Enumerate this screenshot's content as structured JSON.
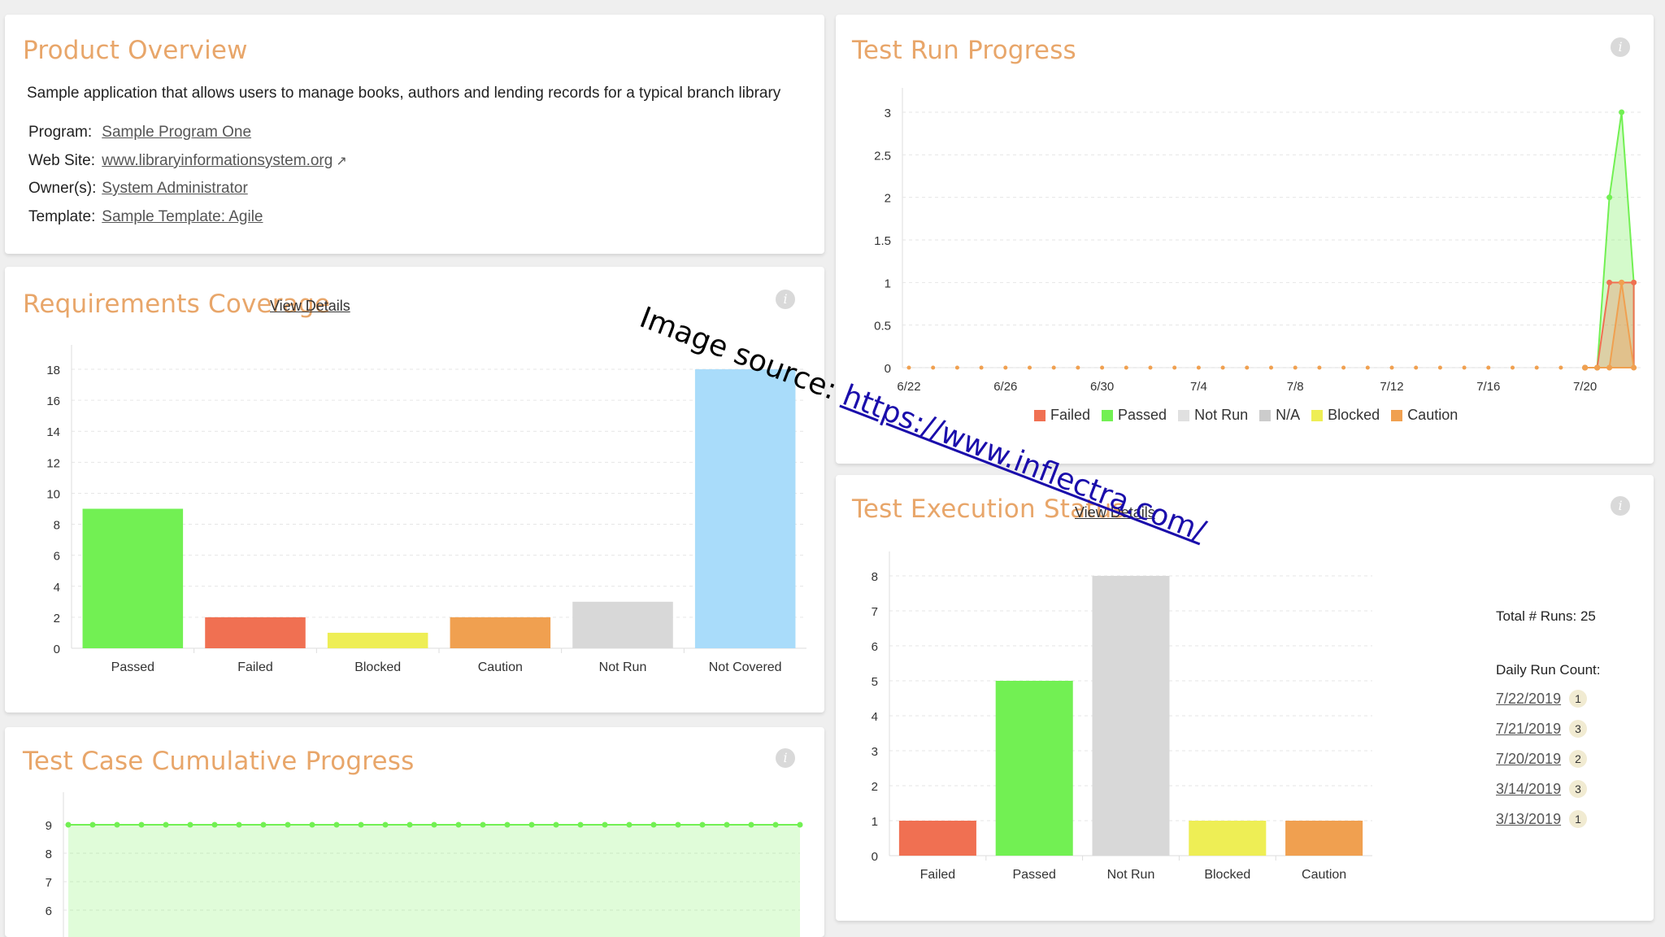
{
  "product_overview": {
    "title": "Product Overview",
    "description": "Sample application that allows users to manage books, authors and lending records for a typical branch library",
    "program_label": "Program:",
    "program_value": "Sample Program One",
    "website_label": "Web Site:",
    "website_value": "www.libraryinformationsystem.org",
    "owner_label": "Owner(s):",
    "owner_value": "System Administrator",
    "template_label": "Template:",
    "template_value": "Sample Template: Agile"
  },
  "requirements_coverage": {
    "title": "Requirements Coverage",
    "view_details": "View Details",
    "chart_data": {
      "type": "bar",
      "categories": [
        "Passed",
        "Failed",
        "Blocked",
        "Caution",
        "Not Run",
        "Not Covered"
      ],
      "values": [
        9,
        2,
        1,
        2,
        3,
        18
      ],
      "colors": [
        "#72f053",
        "#f07052",
        "#eeee55",
        "#f0a050",
        "#d8d8d8",
        "#a9dcfa"
      ],
      "yticks": [
        0,
        2,
        4,
        6,
        8,
        10,
        12,
        14,
        16,
        18
      ],
      "ylim": [
        0,
        18
      ]
    }
  },
  "test_case_cumulative": {
    "title": "Test Case Cumulative Progress",
    "chart_data": {
      "type": "area",
      "yticks": [
        6,
        7,
        8,
        9
      ],
      "value": 9,
      "points": 31,
      "color": "#72f053"
    }
  },
  "test_run_progress": {
    "title": "Test Run Progress",
    "legend": [
      "Failed",
      "Passed",
      "Not Run",
      "N/A",
      "Blocked",
      "Caution"
    ],
    "legend_colors": [
      "#f07052",
      "#72f053",
      "#e0e0e0",
      "#cccccc",
      "#eeee55",
      "#f0a050"
    ],
    "chart_data": {
      "type": "area",
      "xticks": [
        "6/22",
        "6/26",
        "6/30",
        "7/4",
        "7/8",
        "7/12",
        "7/16",
        "7/20"
      ],
      "yticks": [
        "0",
        "0.5",
        "1",
        "1.5",
        "2",
        "2.5",
        "3"
      ],
      "ylim": [
        0,
        3
      ],
      "series": [
        {
          "name": "Passed",
          "color": "#72f053",
          "tail": [
            0,
            0,
            2,
            3,
            1
          ]
        },
        {
          "name": "Failed",
          "color": "#f07052",
          "tail": [
            0,
            0,
            1,
            1,
            1
          ]
        },
        {
          "name": "Caution",
          "color": "#f0a050",
          "tail": [
            0,
            0,
            0,
            1,
            0
          ]
        }
      ]
    }
  },
  "test_execution_status": {
    "title": "Test Execution Status",
    "view_details": "View Details",
    "total_runs": "Total # Runs: 25",
    "daily_run_count_label": "Daily Run Count:",
    "daily_runs": [
      {
        "date": "7/22/2019",
        "count": "1"
      },
      {
        "date": "7/21/2019",
        "count": "3"
      },
      {
        "date": "7/20/2019",
        "count": "2"
      },
      {
        "date": "3/14/2019",
        "count": "3"
      },
      {
        "date": "3/13/2019",
        "count": "1"
      }
    ],
    "chart_data": {
      "type": "bar",
      "categories": [
        "Failed",
        "Passed",
        "Not Run",
        "Blocked",
        "Caution"
      ],
      "values": [
        1,
        5,
        8,
        1,
        1
      ],
      "colors": [
        "#f07052",
        "#72f053",
        "#d8d8d8",
        "#eeee55",
        "#f0a050"
      ],
      "yticks": [
        0,
        1,
        2,
        3,
        4,
        5,
        6,
        7,
        8
      ],
      "ylim": [
        0,
        8
      ]
    }
  },
  "watermark": {
    "prefix": "Image source: ",
    "link": "https://www.inflectra.com/"
  }
}
